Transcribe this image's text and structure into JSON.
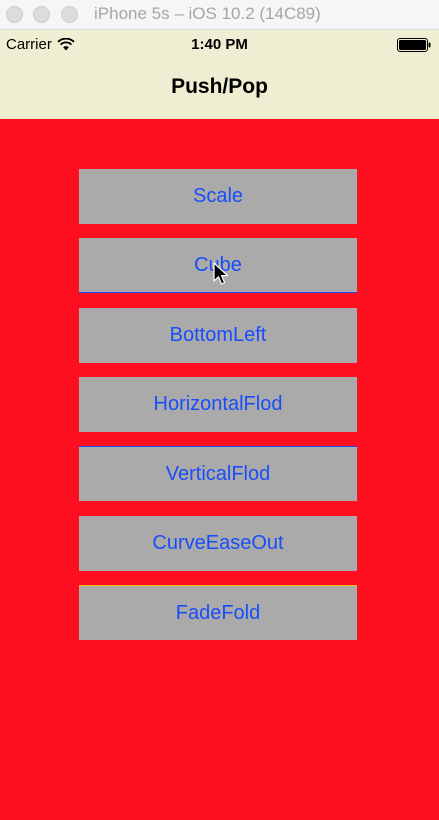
{
  "window": {
    "title": "iPhone 5s – iOS 10.2 (14C89)"
  },
  "status_bar": {
    "carrier": "Carrier",
    "time": "1:40 PM",
    "icons": [
      "wifi-icon",
      "battery-icon"
    ]
  },
  "nav": {
    "title": "Push/Pop"
  },
  "buttons": [
    {
      "label": "Scale"
    },
    {
      "label": "Cube"
    },
    {
      "label": "BottomLeft"
    },
    {
      "label": "HorizontalFlod"
    },
    {
      "label": "VerticalFlod"
    },
    {
      "label": "CurveEaseOut"
    },
    {
      "label": "FadeFold"
    }
  ],
  "colors": {
    "background": "#fe0f1f",
    "navbar": "#f0eed2",
    "button": "#aaaaaa",
    "button_text": "#1a4dfa"
  }
}
